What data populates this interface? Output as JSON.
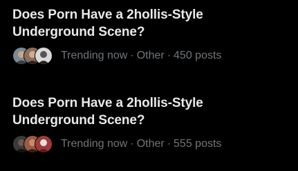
{
  "trends": [
    {
      "title_line1": "Does Porn Have a 2hollis-Style",
      "title_line2": "Underground Scene?",
      "status": "Trending now",
      "category": "Other",
      "posts": "450 posts",
      "separator": "·",
      "avatars": [
        {
          "icon": "avatar-photo-icon",
          "bg": "#7a8a96",
          "accent": "#3b3f44"
        },
        {
          "icon": "avatar-photo-icon",
          "bg": "#8a6e5c",
          "accent": "#2a2522"
        },
        {
          "icon": "avatar-photo-icon",
          "bg": "#d9d9d9",
          "accent": "#222222"
        }
      ]
    },
    {
      "title_line1": "Does Porn Have a 2hollis-Style",
      "title_line2": "Underground Scene?",
      "status": "Trending now",
      "category": "Other",
      "posts": "555 posts",
      "separator": "·",
      "avatars": [
        {
          "icon": "avatar-photo-icon",
          "bg": "#3a3a3a",
          "accent": "#111111"
        },
        {
          "icon": "avatar-photo-icon",
          "bg": "#9b5a48",
          "accent": "#3a1f18"
        },
        {
          "icon": "avatar-photo-icon",
          "bg": "#a03a3a",
          "accent": "#e2e2e2"
        }
      ]
    }
  ],
  "colors": {
    "background": "#000000",
    "title": "#e7e9ea",
    "meta": "#71767b"
  }
}
